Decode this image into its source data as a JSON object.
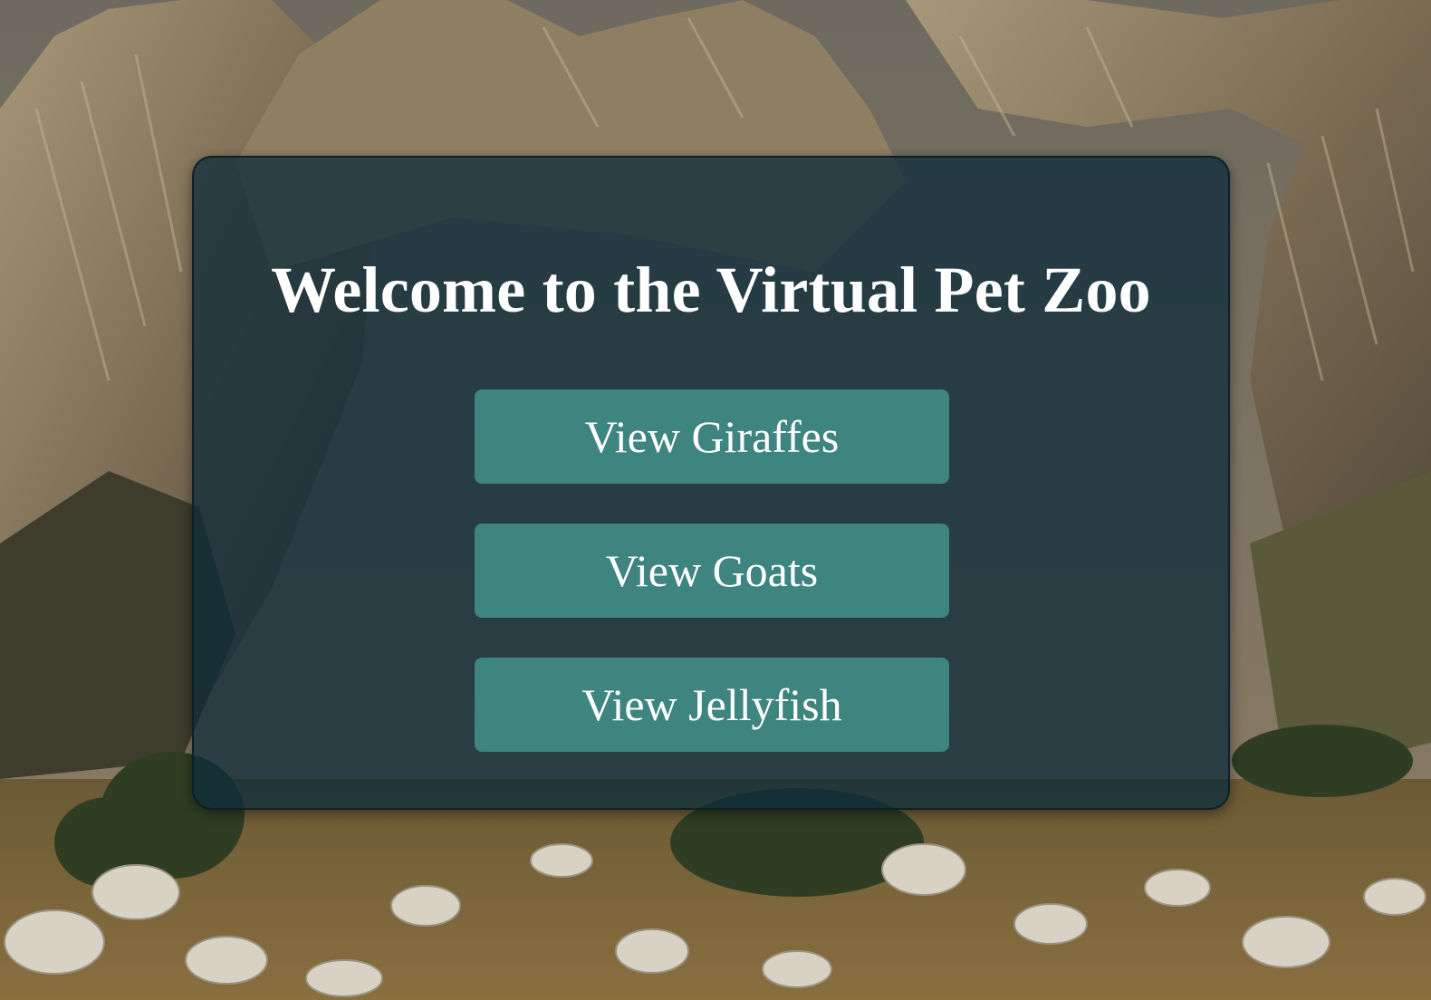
{
  "page": {
    "title": "Welcome to the Virtual Pet Zoo"
  },
  "buttons": [
    {
      "label": "View Giraffes"
    },
    {
      "label": "View Goats"
    },
    {
      "label": "View Jellyfish"
    }
  ],
  "colors": {
    "panel_background": "#0d2b3a",
    "button_background": "#3e857f",
    "text": "#ffffff"
  }
}
